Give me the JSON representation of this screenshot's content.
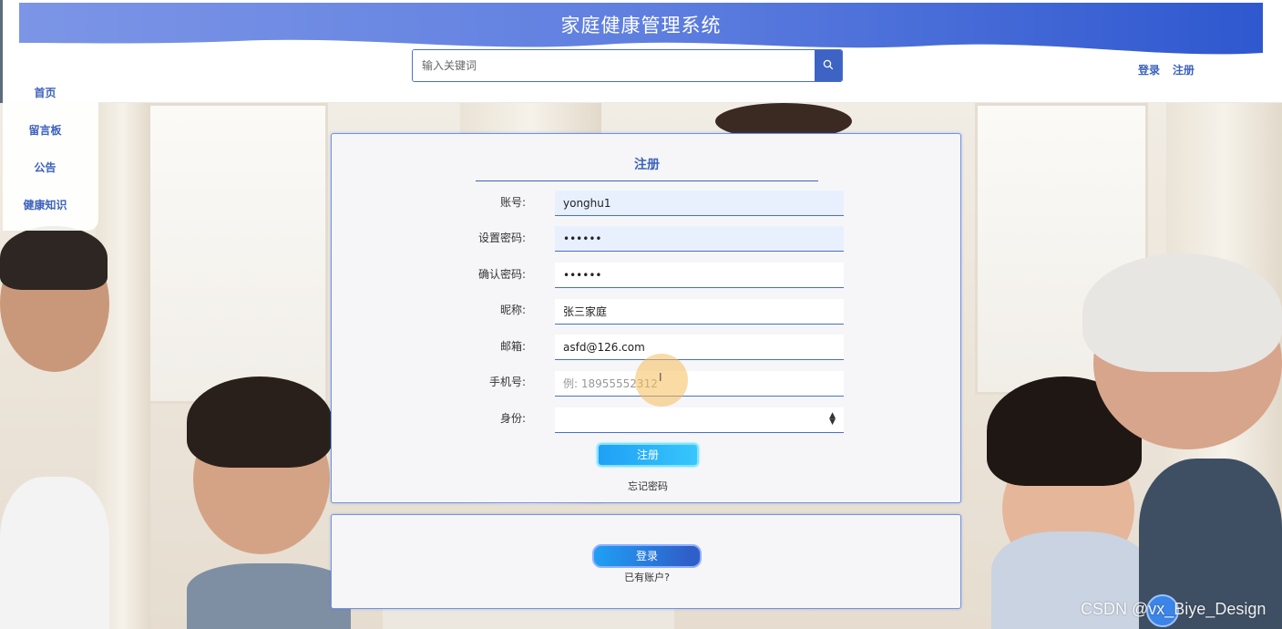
{
  "header": {
    "title": "家庭健康管理系统",
    "search_placeholder": "输入关键词",
    "search_icon": "search-icon",
    "login_label": "登录",
    "register_label": "注册"
  },
  "sidebar": {
    "items": [
      {
        "label": "首页"
      },
      {
        "label": "留言板"
      },
      {
        "label": "公告"
      },
      {
        "label": "健康知识"
      }
    ]
  },
  "register_form": {
    "title": "注册",
    "fields": [
      {
        "label": "账号:",
        "value": "yonghu1",
        "placeholder": ""
      },
      {
        "label": "设置密码:",
        "value": "••••••",
        "placeholder": ""
      },
      {
        "label": "确认密码:",
        "value": "••••••",
        "placeholder": ""
      },
      {
        "label": "昵称:",
        "value": "张三家庭",
        "placeholder": ""
      },
      {
        "label": "邮箱:",
        "value": "asfd@126.com",
        "placeholder": ""
      },
      {
        "label": "手机号:",
        "value": "",
        "placeholder": "例: 18955552312"
      }
    ],
    "role_label": "身份:",
    "role_value": "",
    "submit_label": "注册",
    "forgot_label": "忘记密码"
  },
  "login_panel": {
    "login_label": "登录",
    "has_account_label": "已有账户?"
  },
  "watermark": "CSDN @vx_Biye_Design",
  "colors": {
    "accent": "#3c62bd",
    "banner": "#4a6fd6",
    "button": "#1fa0f5"
  }
}
